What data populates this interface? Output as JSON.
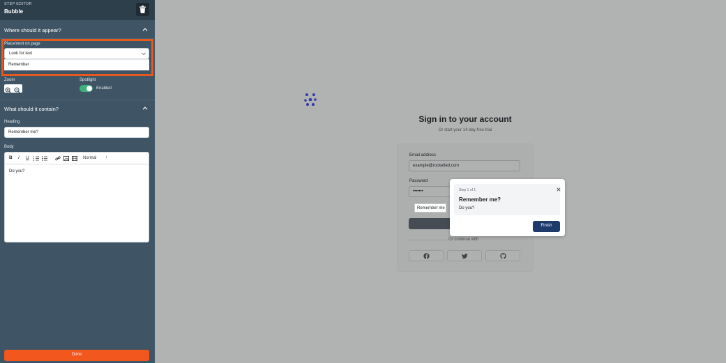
{
  "editor": {
    "kicker": "STEP EDITOR",
    "title": "Bubble"
  },
  "placement_section": {
    "title": "Where should it appear?",
    "placement_label": "Placement on page",
    "placement_value": "Look for text",
    "dropdown_option": "Remember",
    "zoom_label": "Zoom",
    "spotlight_label": "Spotlight",
    "spotlight_state": "Enabled"
  },
  "content_section": {
    "title": "What should it contain?",
    "heading_label": "Heading",
    "heading_value": "Remember me?",
    "body_label": "Body",
    "body_value": "Do you?",
    "toolbar": {
      "bold": "B",
      "italic": "I",
      "underline": "U",
      "text_size": "Normal",
      "text_size_caret": "↕"
    }
  },
  "done_label": "Done",
  "preview": {
    "title": "Sign in to your account",
    "subtitle": "Or start your 14-day free trial",
    "email_label": "Email address",
    "email_value": "example@rocketled.com",
    "password_label": "Password",
    "password_value": "•••••••",
    "remember_label": "Remember me",
    "or_text": "Or continue with",
    "social": [
      "facebook-icon",
      "twitter-icon",
      "github-icon"
    ]
  },
  "bubble": {
    "step": "Step 1 of 1",
    "heading": "Remember me?",
    "body": "Do you?",
    "finish_label": "Finish"
  },
  "colors": {
    "sidebar_bg": "#3f5566",
    "highlight": "#e55a1c",
    "done_button": "#f2571d",
    "toggle_on": "#3bb27a",
    "finish_button": "#1e3a6b",
    "brand_logo": "#2f3aa8"
  }
}
